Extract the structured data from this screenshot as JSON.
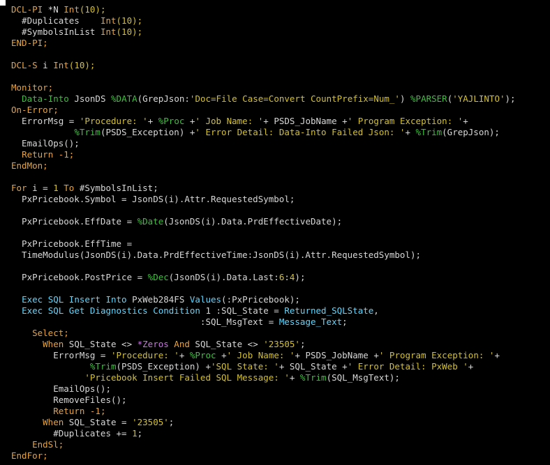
{
  "editor": {
    "lines": [
      [
        [
          "DCL-PI",
          "kw"
        ],
        [
          " *N ",
          "pl"
        ],
        [
          "Int",
          "kw"
        ],
        [
          "(10);",
          "st"
        ]
      ],
      [
        [
          "  #Duplicates    ",
          "pl"
        ],
        [
          "Int",
          "kw"
        ],
        [
          "(10);",
          "st"
        ]
      ],
      [
        [
          "  #SymbolsInList ",
          "pl"
        ],
        [
          "Int",
          "kw"
        ],
        [
          "(10);",
          "st"
        ]
      ],
      [
        [
          "END-PI;",
          "kw"
        ]
      ],
      [],
      [
        [
          "DCL-S",
          "kw"
        ],
        [
          " i ",
          "pl"
        ],
        [
          "Int",
          "kw"
        ],
        [
          "(10);",
          "st"
        ]
      ],
      [],
      [
        [
          "Monitor;",
          "kw"
        ]
      ],
      [
        [
          "  ",
          "pl"
        ],
        [
          "Data-Into",
          "bi"
        ],
        [
          " JsonDS ",
          "pl"
        ],
        [
          "%DATA",
          "bi"
        ],
        [
          "(GrepJson:",
          "pl"
        ],
        [
          "'Doc=File Case=Convert CountPrefix=Num_'",
          "st"
        ],
        [
          ") ",
          "pl"
        ],
        [
          "%PARSER",
          "bi"
        ],
        [
          "(",
          "pl"
        ],
        [
          "'YAJLINTO'",
          "st"
        ],
        [
          ");",
          "pl"
        ]
      ],
      [
        [
          "On-Error;",
          "kw"
        ]
      ],
      [
        [
          "  ErrorMsg = ",
          "pl"
        ],
        [
          "'Procedure: '",
          "st"
        ],
        [
          "+ ",
          "pl"
        ],
        [
          "%Proc",
          "bi"
        ],
        [
          " +",
          "pl"
        ],
        [
          "' Job Name: '",
          "st"
        ],
        [
          "+ PSDS_JobName +",
          "pl"
        ],
        [
          "' Program Exception: '",
          "st"
        ],
        [
          "+",
          "pl"
        ]
      ],
      [
        [
          "            ",
          "pl"
        ],
        [
          "%Trim",
          "bi"
        ],
        [
          "(PSDS_Exception) +",
          "pl"
        ],
        [
          "' Error Detail: Data-Into Failed Json: '",
          "st"
        ],
        [
          "+ ",
          "pl"
        ],
        [
          "%Trim",
          "bi"
        ],
        [
          "(GrepJson);",
          "pl"
        ]
      ],
      [
        [
          "  EmailOps();",
          "pl"
        ]
      ],
      [
        [
          "  ",
          "pl"
        ],
        [
          "Return",
          "kw"
        ],
        [
          " -1;",
          "kw"
        ]
      ],
      [
        [
          "EndMon;",
          "kw"
        ]
      ],
      [],
      [
        [
          "For",
          "kw"
        ],
        [
          " i = ",
          "pl"
        ],
        [
          "1",
          "nm"
        ],
        [
          " To",
          "kw"
        ],
        [
          " #SymbolsInList;",
          "pl"
        ]
      ],
      [
        [
          "  PxPricebook.Symbol = JsonDS(i).Attr.RequestedSymbol;",
          "pl"
        ]
      ],
      [],
      [
        [
          "  PxPricebook.EffDate = ",
          "pl"
        ],
        [
          "%Date",
          "bi"
        ],
        [
          "(JsonDS(i).Data.PrdEffectiveDate);",
          "pl"
        ]
      ],
      [],
      [
        [
          "  PxPricebook.EffTime =",
          "pl"
        ]
      ],
      [
        [
          "  TimeModulus(JsonDS(i).Data.PrdEffectiveTime:JsonDS(i).Attr.RequestedSymbol);",
          "pl"
        ]
      ],
      [],
      [
        [
          "  PxPricebook.PostPrice = ",
          "pl"
        ],
        [
          "%Dec",
          "bi"
        ],
        [
          "(JsonDS(i).Data.Last:",
          "pl"
        ],
        [
          "6",
          "nm"
        ],
        [
          ":",
          "pl"
        ],
        [
          "4",
          "nm"
        ],
        [
          ");",
          "pl"
        ]
      ],
      [],
      [
        [
          "  ",
          "pl"
        ],
        [
          "Exec SQL Insert Into",
          "cy"
        ],
        [
          " PxWeb284FS ",
          "pl"
        ],
        [
          "Values",
          "cy"
        ],
        [
          "(:PxPricebook);",
          "pl"
        ]
      ],
      [
        [
          "  ",
          "pl"
        ],
        [
          "Exec SQL Get Diagnostics Condition",
          "cy"
        ],
        [
          " 1 :SQL_State = ",
          "pl"
        ],
        [
          "Returned_SQLState",
          "cy"
        ],
        [
          ",",
          "pl"
        ]
      ],
      [
        [
          "                                    :SQL_MsgText = ",
          "pl"
        ],
        [
          "Message_Text",
          "cy"
        ],
        [
          ";",
          "pl"
        ]
      ],
      [
        [
          "    ",
          "pl"
        ],
        [
          "Select;",
          "kw"
        ]
      ],
      [
        [
          "      ",
          "pl"
        ],
        [
          "When",
          "kw"
        ],
        [
          " SQL_State <> ",
          "pl"
        ],
        [
          "*Zeros",
          "mg"
        ],
        [
          " And",
          "kw"
        ],
        [
          " SQL_State <> ",
          "pl"
        ],
        [
          "'23505'",
          "st"
        ],
        [
          ";",
          "pl"
        ]
      ],
      [
        [
          "        ErrorMsg = ",
          "pl"
        ],
        [
          "'Procedure: '",
          "st"
        ],
        [
          "+ ",
          "pl"
        ],
        [
          "%Proc",
          "bi"
        ],
        [
          " +",
          "pl"
        ],
        [
          "' Job Name: '",
          "st"
        ],
        [
          "+ PSDS_JobName +",
          "pl"
        ],
        [
          "' Program Exception: '",
          "st"
        ],
        [
          "+",
          "pl"
        ]
      ],
      [
        [
          "               ",
          "pl"
        ],
        [
          "%Trim",
          "bi"
        ],
        [
          "(PSDS_Exception) +",
          "pl"
        ],
        [
          "'SQL State: '",
          "st"
        ],
        [
          "+ SQL_State +",
          "pl"
        ],
        [
          "' Error Detail: PxWeb '",
          "st"
        ],
        [
          "+",
          "pl"
        ]
      ],
      [
        [
          "              ",
          "pl"
        ],
        [
          "'Pricebook Insert Failed SQL Message: '",
          "st"
        ],
        [
          "+ ",
          "pl"
        ],
        [
          "%Trim",
          "bi"
        ],
        [
          "(SQL_MsgText);",
          "pl"
        ]
      ],
      [
        [
          "        EmailOps();",
          "pl"
        ]
      ],
      [
        [
          "        RemoveFiles();",
          "pl"
        ]
      ],
      [
        [
          "        ",
          "pl"
        ],
        [
          "Return",
          "kw"
        ],
        [
          " -1;",
          "kw"
        ]
      ],
      [
        [
          "      ",
          "pl"
        ],
        [
          "When",
          "kw"
        ],
        [
          " SQL_State = ",
          "pl"
        ],
        [
          "'23505'",
          "st"
        ],
        [
          ";",
          "pl"
        ]
      ],
      [
        [
          "        #Duplicates += ",
          "pl"
        ],
        [
          "1",
          "nm"
        ],
        [
          ";",
          "pl"
        ]
      ],
      [
        [
          "    ",
          "pl"
        ],
        [
          "EndSl;",
          "kw"
        ]
      ],
      [
        [
          "EndFor;",
          "kw"
        ]
      ]
    ]
  }
}
